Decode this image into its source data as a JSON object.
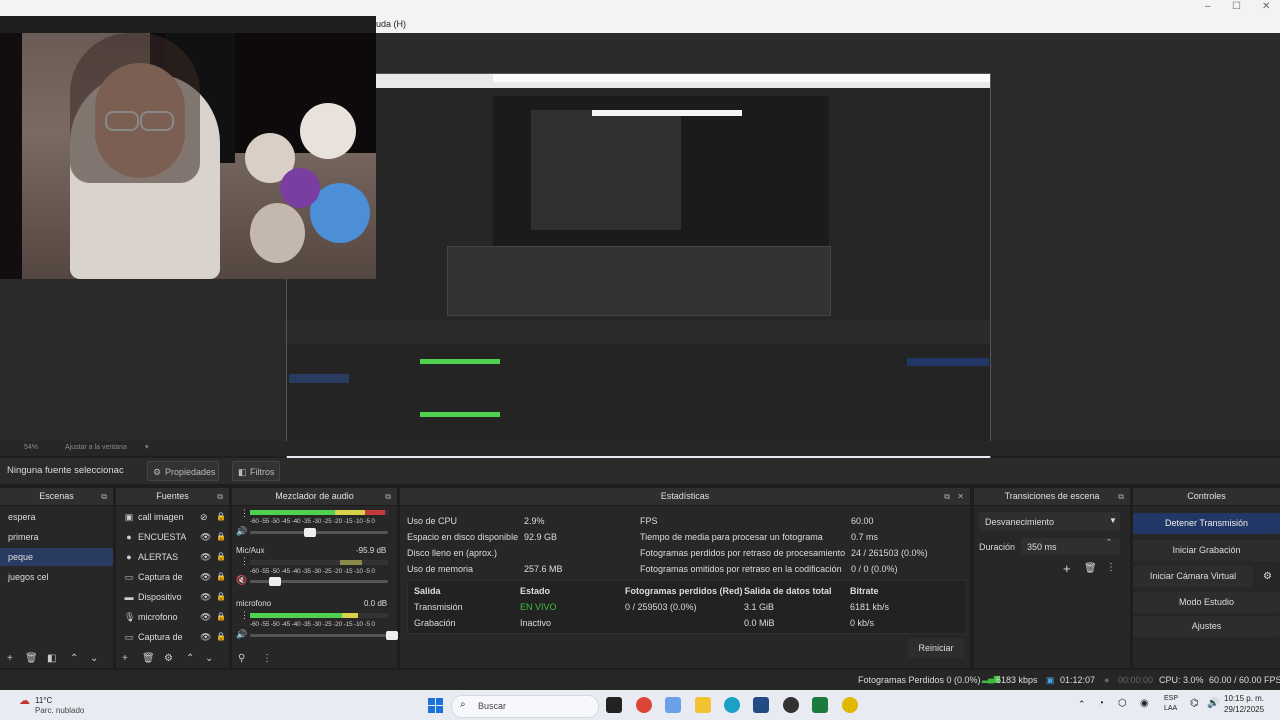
{
  "menubar": {
    "help_menu": "uda (H)"
  },
  "window_controls": {
    "minimize": "–",
    "maximize": "☐",
    "close": "✕"
  },
  "preview_zoom": {
    "zoom": "54%",
    "fit_label": "Ajustar a la ventana"
  },
  "source_toolbar": {
    "no_source_label": "Ninguna fuente seleccionac",
    "properties_label": "Propiedades",
    "filters_label": "Filtros"
  },
  "scenes": {
    "title": "Escenas",
    "items": [
      {
        "label": "espera",
        "selected": false
      },
      {
        "label": "primera",
        "selected": false
      },
      {
        "label": "peque",
        "selected": true
      },
      {
        "label": "juegos cel",
        "selected": false
      }
    ]
  },
  "sources": {
    "title": "Fuentes",
    "items": [
      {
        "label": "call imagen",
        "icon": "image-icon"
      },
      {
        "label": "ENCUESTA",
        "icon": "browser-icon"
      },
      {
        "label": "ALERTAS",
        "icon": "browser-icon"
      },
      {
        "label": "Captura de",
        "icon": "window-capture-icon"
      },
      {
        "label": "Dispositivo",
        "icon": "camera-icon"
      },
      {
        "label": "microfono",
        "icon": "microphone-icon"
      },
      {
        "label": "Captura de",
        "icon": "window-capture-icon"
      }
    ]
  },
  "mixer": {
    "title": "Mezclador de audio",
    "channels": [
      {
        "name": "",
        "db": "",
        "level": 0.95
      },
      {
        "name": "Mic/Aux",
        "db": "-95.9 dB",
        "level": 0.0
      },
      {
        "name": "microfono",
        "db": "0.0 dB",
        "level": 0.75
      }
    ],
    "scale": "-60 -55 -50 -45 -40 -35 -30 -25 -20 -15 -10 -5 0"
  },
  "stats": {
    "title": "Estadísticas",
    "rows": [
      {
        "label": "Uso de CPU",
        "value": "2.9%"
      },
      {
        "label": "Espacio en disco disponible",
        "value": "92.9 GB"
      },
      {
        "label": "Disco lleno en (aprox.)",
        "value": ""
      },
      {
        "label": "Uso de memoria",
        "value": "257.6 MB"
      }
    ],
    "rows_right": [
      {
        "label": "FPS",
        "value": "60.00"
      },
      {
        "label": "Tiempo de media para procesar un fotograma",
        "value": "0.7 ms"
      },
      {
        "label": "Fotogramas perdidos por retraso de procesamiento",
        "value": "24 / 261503 (0.0%)"
      },
      {
        "label": "Fotogramas omitidos por retraso en la codificación",
        "value": "0 / 0 (0.0%)"
      }
    ],
    "table": {
      "headers": [
        "Salida",
        "Estado",
        "Fotogramas perdidos (Red)",
        "Salida de datos total",
        "Bitrate"
      ],
      "rows": [
        [
          "Transmisión",
          "EN VIVO",
          "0 / 259503 (0.0%)",
          "3.1 GiB",
          "6181 kb/s"
        ],
        [
          "Grabación",
          "Inactivo",
          "",
          "0.0 MiB",
          "0 kb/s"
        ]
      ]
    },
    "reset_label": "Reiniciar"
  },
  "transitions": {
    "title": "Transiciones de escena",
    "selected": "Desvanecimiento",
    "duration_label": "Duración",
    "duration_value": "350 ms"
  },
  "controls": {
    "title": "Controles",
    "buttons": [
      {
        "label": "Detener Transmisión",
        "active": true
      },
      {
        "label": "Iniciar Grabación",
        "active": false
      },
      {
        "label": "Iniciar Cámara Virtual",
        "active": false
      },
      {
        "label": "Modo Estudio",
        "active": false
      },
      {
        "label": "Ajustes",
        "active": false
      }
    ]
  },
  "statusbar": {
    "dropped": "Fotogramas Perdidos 0 (0.0%)",
    "kbps": "6183 kbps",
    "live_time": "01:12:07",
    "rec_time": "00:00:00",
    "cpu": "CPU: 3.0%",
    "fps": "60.00 / 60.00 FPS"
  },
  "taskbar": {
    "weather_temp": "11°C",
    "weather_desc": "Parc. nublado",
    "search_placeholder": "Buscar",
    "lang_top": "ESP",
    "lang_bottom": "LAA",
    "time": "10:15 p. m.",
    "date": "29/12/2025"
  },
  "colors": {
    "accent": "#2a3b62",
    "live": "#3fbf3f",
    "meter_green": "#4fd24f"
  }
}
